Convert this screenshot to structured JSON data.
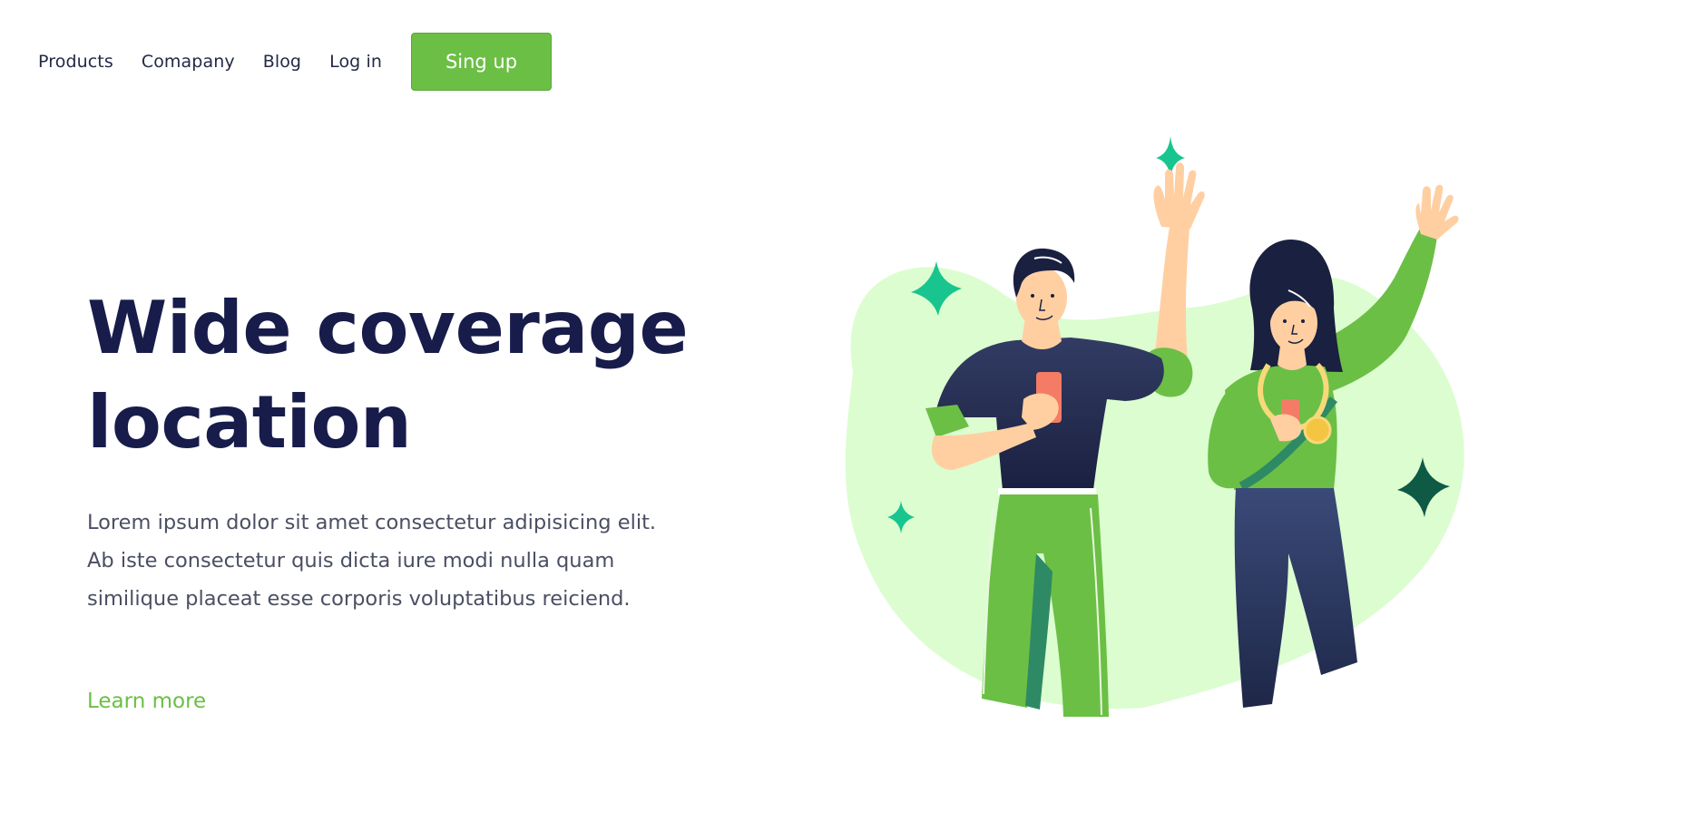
{
  "nav": {
    "links": [
      "Products",
      "Comapany",
      "Blog",
      "Log in"
    ],
    "signup_label": "Sing up"
  },
  "hero": {
    "title_line_1": "Wide coverage",
    "title_line_2": "location",
    "body_line_1": "Lorem ipsum dolor sit amet consectetur adipisicing elit.",
    "body_line_2": "Ab iste consectetur quis dicta iure modi nulla quam",
    "body_line_3": "similique placeat esse corporis voluptatibus reiciend.",
    "learn_more": "Learn more"
  },
  "colors": {
    "accent_green": "#6bbf45",
    "title_navy": "#171c4b",
    "blob_green": "#dcfdd0",
    "sparkle_teal": "#19c58f",
    "sparkle_dark": "#0f5a45"
  },
  "illustration": {
    "icon": "people-waving-illustration"
  }
}
